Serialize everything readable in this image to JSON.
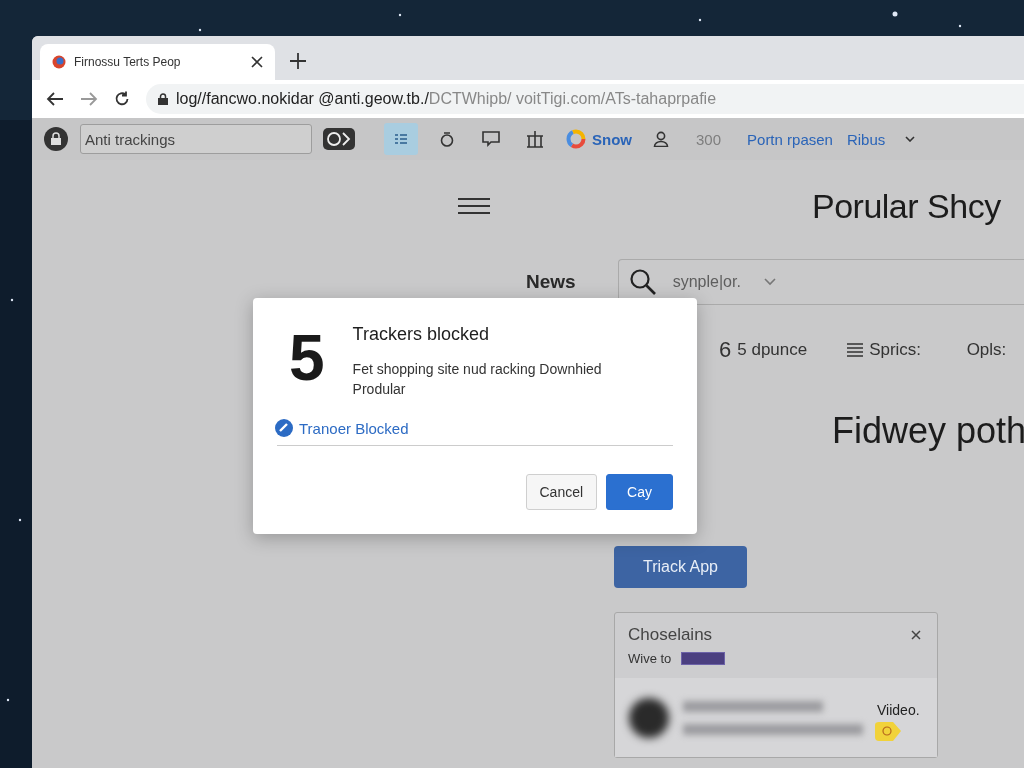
{
  "browser": {
    "tab": {
      "title": "Firnossu Terts Peop"
    },
    "address": {
      "host": "log//fancwo.nokidar @anti.geow.tb./",
      "path": "DCTWhipb/ voitTigi.com/ATs-tahaprpafie"
    }
  },
  "toolbar": {
    "field": {
      "value": "Anti trackings"
    },
    "grid_active": true,
    "profile": "Snow",
    "count": "300",
    "links": [
      "Portn rpasen",
      "Ribus"
    ]
  },
  "page": {
    "title": "Porular Shcy",
    "nav": "News",
    "search": {
      "placeholder": "synple|or."
    },
    "stats": [
      {
        "kind": "number",
        "value": "6",
        "label": "5 dpunce"
      },
      {
        "kind": "list",
        "label": "Sprics:"
      },
      {
        "kind": "plain",
        "label": "Opls:"
      }
    ],
    "heading": "Fidwey poth",
    "action": "Triack App",
    "card": {
      "title": "Choselains",
      "text": "Wive to",
      "video": "Viideo."
    }
  },
  "dialog": {
    "count": "5",
    "title": "Trackers blocked",
    "body": "Fet shopping site nud racking Downhied Prodular",
    "link": "Tranoer Blocked",
    "buttons": [
      {
        "kind": "cancel",
        "label": "Cancel"
      },
      {
        "kind": "confirm",
        "label": "Cay"
      }
    ]
  }
}
